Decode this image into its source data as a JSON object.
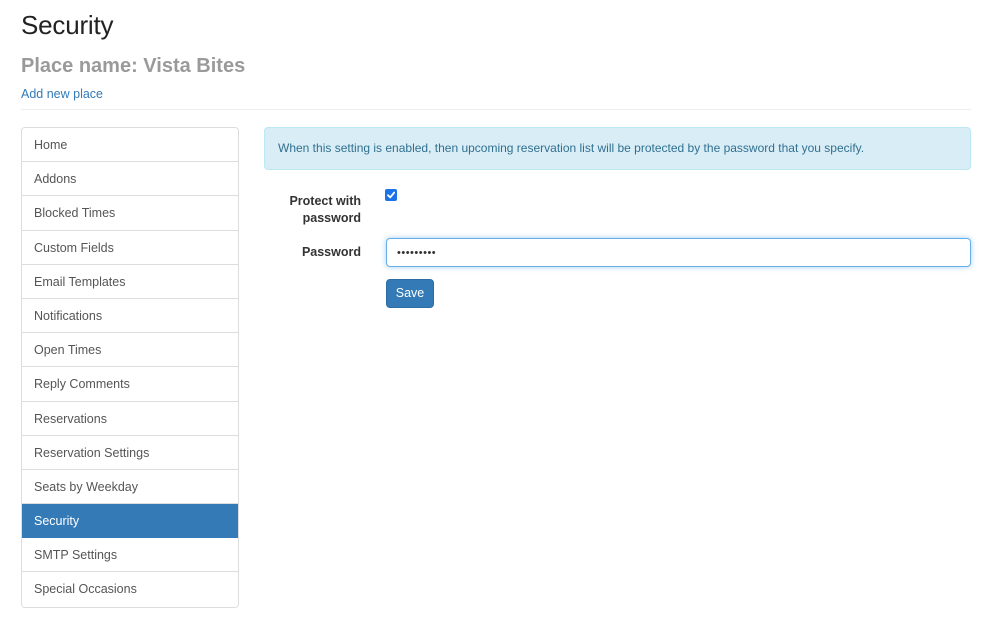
{
  "header": {
    "title": "Security",
    "place_name": "Place name: Vista Bites",
    "add_place_link": "Add new place"
  },
  "sidebar": {
    "active_index": 11,
    "items": [
      {
        "label": "Home"
      },
      {
        "label": "Addons"
      },
      {
        "label": "Blocked Times"
      },
      {
        "label": "Custom Fields"
      },
      {
        "label": "Email Templates"
      },
      {
        "label": "Notifications"
      },
      {
        "label": "Open Times"
      },
      {
        "label": "Reply Comments"
      },
      {
        "label": "Reservations"
      },
      {
        "label": "Reservation Settings"
      },
      {
        "label": "Seats by Weekday"
      },
      {
        "label": "Security"
      },
      {
        "label": "SMTP Settings"
      },
      {
        "label": "Special Occasions"
      }
    ]
  },
  "main": {
    "info_text": "When this setting is enabled, then upcoming reservation list will be protected by the password that you specify.",
    "protect_label_line1": "Protect with",
    "protect_label_line2": "password",
    "protect_checked": true,
    "password_label": "Password",
    "password_value": "•••••••••",
    "save_label": "Save"
  },
  "colors": {
    "primary": "#337ab7",
    "info_bg": "#d9edf7",
    "info_text": "#31708f"
  }
}
